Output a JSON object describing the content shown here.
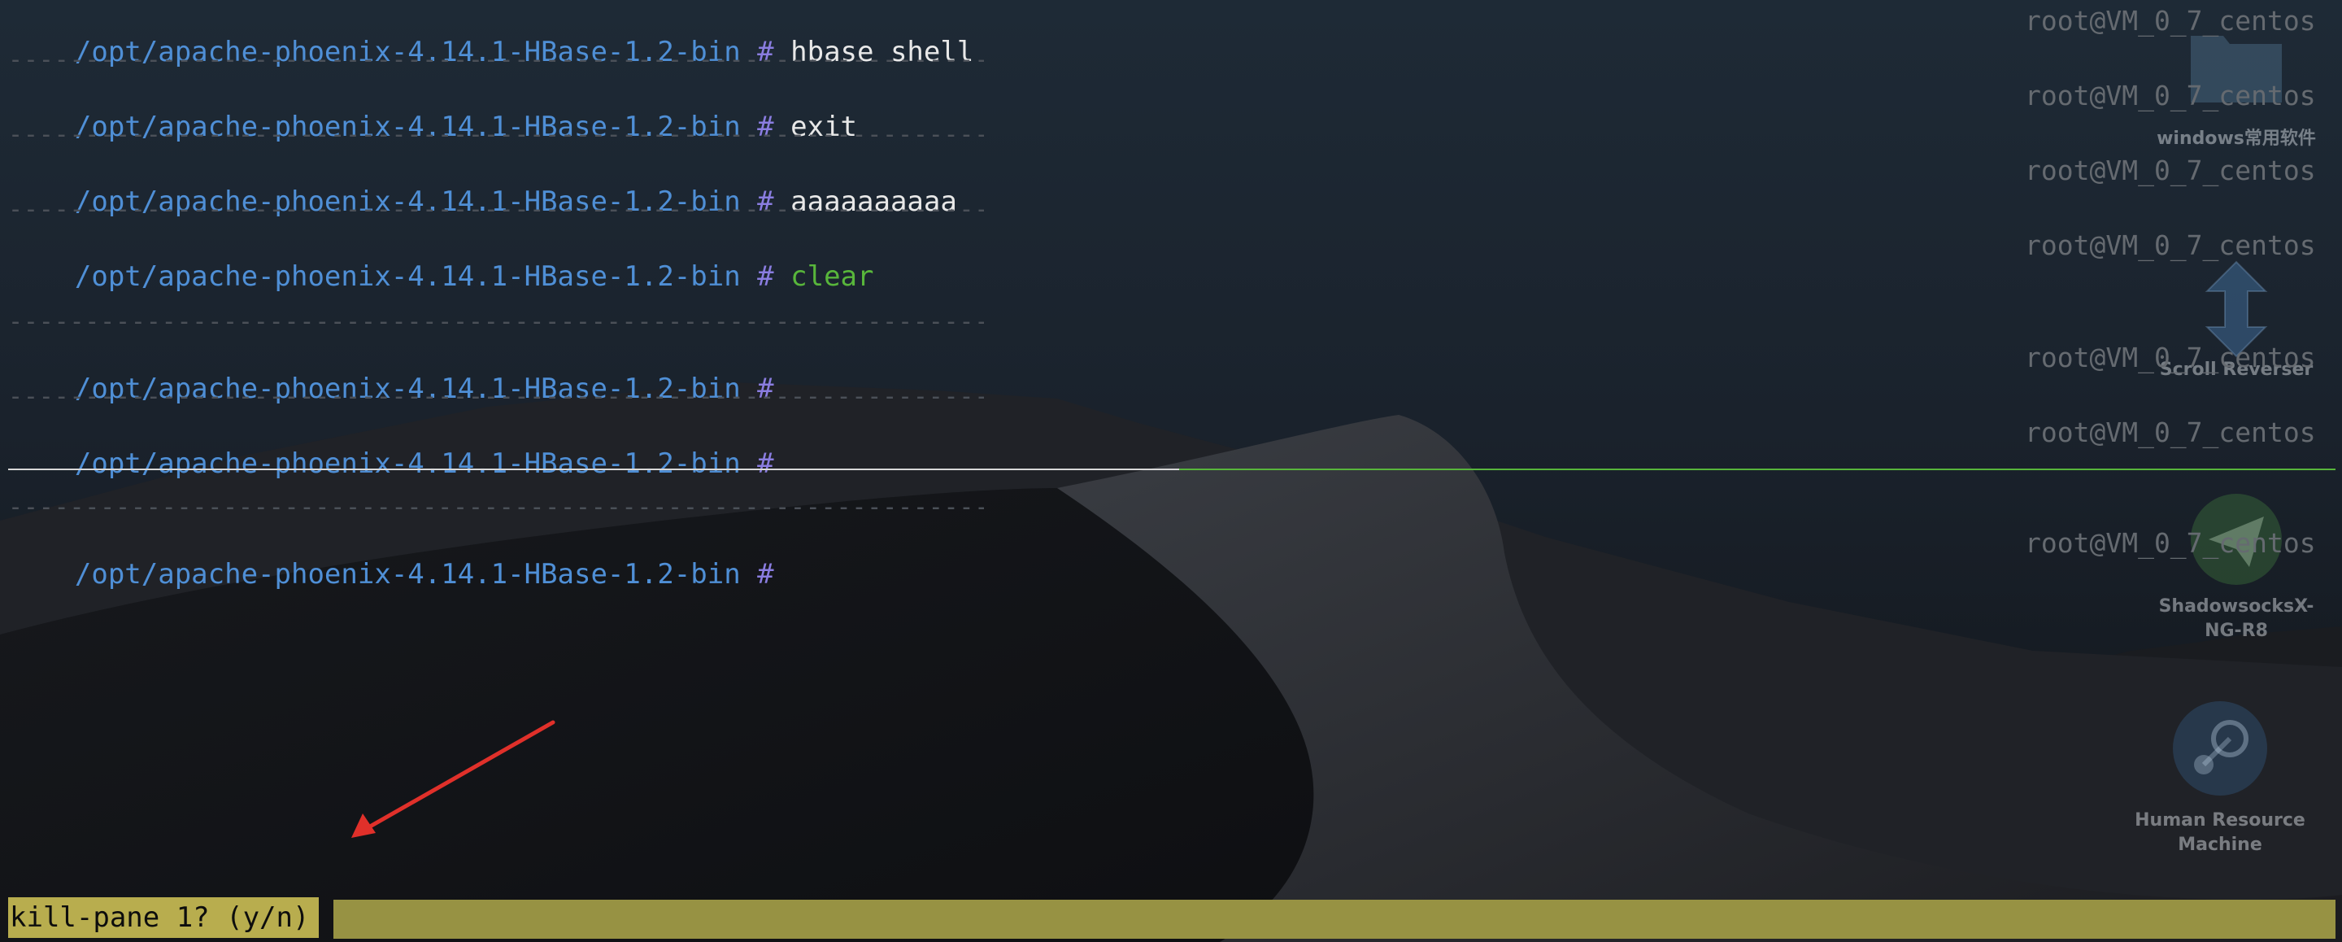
{
  "terminal": {
    "lines": [
      {
        "path": "/opt/apache-phoenix-4.14.1-HBase-1.2-bin",
        "hash": "#",
        "command": "hbase shell",
        "host": "root@VM_0_7_centos"
      },
      {
        "path": "/opt/apache-phoenix-4.14.1-HBase-1.2-bin",
        "hash": "#",
        "command": "exit",
        "host": "root@VM_0_7_centos"
      },
      {
        "path": "/opt/apache-phoenix-4.14.1-HBase-1.2-bin",
        "hash": "#",
        "command": "aaaaaaaaaa",
        "host": "root@VM_0_7_centos"
      },
      {
        "path": "/opt/apache-phoenix-4.14.1-HBase-1.2-bin",
        "hash": "#",
        "command": "clear",
        "host": "root@VM_0_7_centos"
      },
      {
        "path": "/opt/apache-phoenix-4.14.1-HBase-1.2-bin",
        "hash": "#",
        "command": "",
        "host": "root@VM_0_7_centos"
      },
      {
        "path": "/opt/apache-phoenix-4.14.1-HBase-1.2-bin",
        "hash": "#",
        "command": "",
        "host": "root@VM_0_7_centos"
      },
      {
        "path": "/opt/apache-phoenix-4.14.1-HBase-1.2-bin",
        "hash": "#",
        "command": "",
        "host": "root@VM_0_7_centos"
      }
    ],
    "separator": "----------------------------------------------------------------------------------------------------------------------------"
  },
  "status_bar": {
    "prompt": "kill-pane 1? (y/n)"
  },
  "desktop_icons": [
    {
      "label": "windows常用软件",
      "icon": "folder-icon"
    },
    {
      "label": "Scroll Reverser",
      "icon": "scroll-reverser-icon"
    },
    {
      "label": "ShadowsocksX-NG-R8",
      "label_line1": "ShadowsocksX-",
      "label_line2": "NG-R8",
      "icon": "paper-plane-icon"
    },
    {
      "label": "Human Resource Machine",
      "label_line1": "Human Resource",
      "label_line2": "Machine",
      "icon": "steam-icon"
    }
  ],
  "colors": {
    "path": "#4f8fd6",
    "hash": "#8a7de0",
    "command": "#e8e8e8",
    "command_valid": "#58b63b",
    "status_prompt_bg": "#b8ad4e",
    "status_bar_bg": "#979243",
    "annotation_arrow": "#e0302a"
  }
}
